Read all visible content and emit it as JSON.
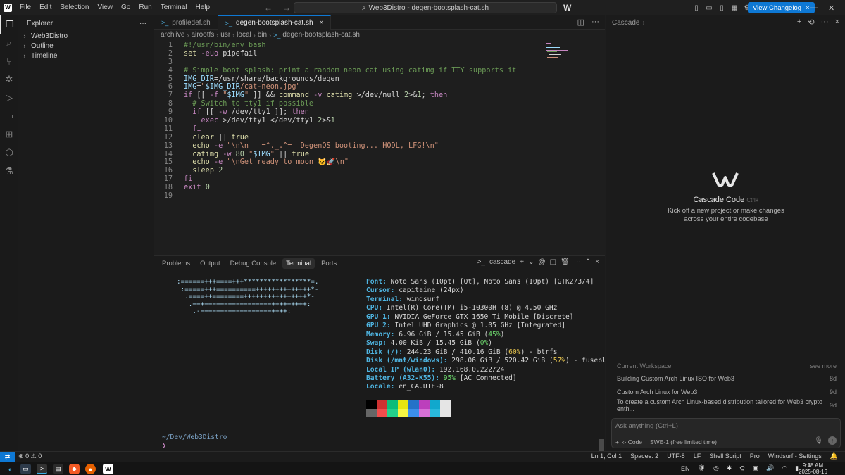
{
  "menu": [
    "File",
    "Edit",
    "Selection",
    "View",
    "Go",
    "Run",
    "Terminal",
    "Help"
  ],
  "command_center": "Web3Distro - degen-bootsplash-cat.sh",
  "changelog_button": "View Changelog",
  "explorer": {
    "title": "Explorer",
    "sections": [
      "Web3Distro",
      "Outline",
      "Timeline"
    ]
  },
  "tabs": [
    {
      "label": "profiledef.sh",
      "active": false
    },
    {
      "label": "degen-bootsplash-cat.sh",
      "active": true
    }
  ],
  "breadcrumb": [
    "archlive",
    "airootfs",
    "usr",
    "local",
    "bin",
    "degen-bootsplash-cat.sh"
  ],
  "code_lines": [
    "#!/usr/bin/env bash",
    "set -euo pipefail",
    "",
    "# Simple boot splash: print a random neon cat using catimg if TTY supports it",
    "IMG_DIR=/usr/share/backgrounds/degen",
    "IMG=\"$IMG_DIR/cat-neon.jpg\"",
    "if [[ -f \"$IMG\" ]] && command -v catimg >/dev/null 2>&1; then",
    "  # Switch to tty1 if possible",
    "  if [[ -w /dev/tty1 ]]; then",
    "    exec >/dev/tty1 </dev/tty1 2>&1",
    "  fi",
    "  clear || true",
    "  echo -e \"\\n\\n   =^._.^=  DegenOS booting... HODL, LFG!\\n\"",
    "  catimg -w 80 \"$IMG\" || true",
    "  echo -e \"\\nGet ready to moon 😼🚀\\n\"",
    "  sleep 2",
    "fi",
    "exit 0",
    ""
  ],
  "panel": {
    "tabs": [
      "Problems",
      "Output",
      "Debug Console",
      "Terminal",
      "Ports"
    ],
    "active_tab": "Terminal",
    "terminal_name": "cascade"
  },
  "terminal": {
    "art": [
      ":======+++====+++*****************=.",
      " :=====+++==========++++++++++++++*-",
      "  .====++========++++++++++++++++*-",
      "   .==+=================+++++++++:",
      "    .-==================++++:"
    ],
    "info": [
      {
        "k": "Font",
        "v": "Noto Sans (10pt) [Qt], Noto Sans (10pt) [GTK2/3/4]"
      },
      {
        "k": "Cursor",
        "v": "capitaine (24px)"
      },
      {
        "k": "Terminal",
        "v": "windsurf"
      },
      {
        "k": "CPU",
        "v": "Intel(R) Core(TM) i5-10300H (8) @ 4.50 GHz"
      },
      {
        "k": "GPU 1",
        "v": "NVIDIA GeForce GTX 1650 Ti Mobile [Discrete]"
      },
      {
        "k": "GPU 2",
        "v": "Intel UHD Graphics @ 1.05 GHz [Integrated]"
      },
      {
        "k": "Memory",
        "v": "6.96 GiB / 15.45 GiB (",
        "p": "45%",
        "pc": "pg",
        "t": ")"
      },
      {
        "k": "Swap",
        "v": "4.00 KiB / 15.45 GiB (",
        "p": "0%",
        "pc": "pg",
        "t": ")"
      },
      {
        "k": "Disk (/)",
        "v": "244.23 GiB / 410.16 GiB (",
        "p": "60%",
        "pc": "py",
        "t": ") - btrfs"
      },
      {
        "k": "Disk (/mnt/windows)",
        "v": "298.06 GiB / 520.42 GiB (",
        "p": "57%",
        "pc": "py",
        "t": ") - fuseblk"
      },
      {
        "k": "Local IP (wlan0)",
        "v": "192.168.0.222/24"
      },
      {
        "k": "Battery (A32-K55)",
        "v": "",
        "p": "95%",
        "pc": "pg",
        "t": " [AC Connected]"
      },
      {
        "k": "Locale",
        "v": "en_CA.UTF-8"
      }
    ],
    "palette_top": [
      "#000000",
      "#cd3131",
      "#0dbc79",
      "#e5e510",
      "#2472c8",
      "#bc3fbc",
      "#11a8cd",
      "#e5e5e5"
    ],
    "palette_bottom": [
      "#666666",
      "#f14c4c",
      "#23d18b",
      "#f5f543",
      "#3b8eea",
      "#d670d6",
      "#29b8db",
      "#e5e5e5"
    ],
    "prompt_path": "~/Dev/Web3Distro",
    "prompt_symbol": "❯"
  },
  "cascade": {
    "header": "Cascade",
    "title": "Cascade Code",
    "shortcut": "Ctrl+",
    "subtitle_1": "Kick off a new project or make changes",
    "subtitle_2": "across your entire codebase",
    "workspace_label": "Current Workspace",
    "see_more": "see more",
    "items": [
      {
        "title": "Building Custom Arch Linux ISO for Web3",
        "age": "8d"
      },
      {
        "title": "Custom Arch Linux for Web3",
        "age": "9d"
      },
      {
        "title": "To create a custom Arch Linux-based distribution tailored for Web3 crypto enth...",
        "age": "9d"
      }
    ],
    "ask_placeholder": "Ask anything (Ctrl+L)",
    "code_label": "Code",
    "model": "SWE-1 (free limited time)"
  },
  "status": {
    "problems": "0",
    "warnings": "0",
    "right": [
      "Ln 1, Col 1",
      "Spaces: 2",
      "UTF-8",
      "LF",
      "Shell Script",
      "Pro",
      "Windsurf - Settings"
    ]
  },
  "taskbar": {
    "lang": "EN",
    "time": "9:38 AM",
    "date": "2025-08-16"
  }
}
